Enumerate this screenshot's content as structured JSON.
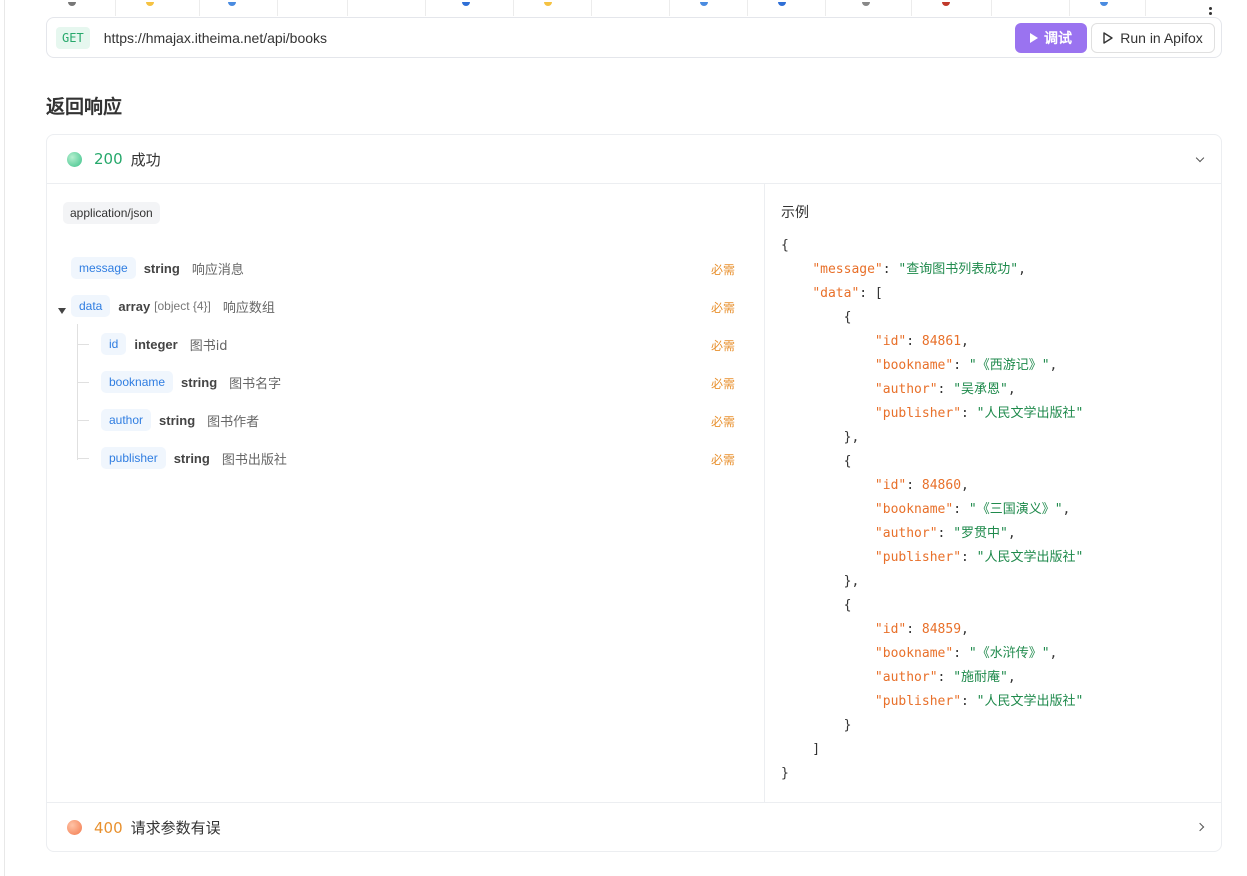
{
  "request": {
    "method": "GET",
    "url": "https://hmajax.itheima.net/api/books",
    "debug_label": "调试",
    "run_label": "Run in Apifox"
  },
  "response_section": {
    "title": "返回响应"
  },
  "responses": [
    {
      "code": "200",
      "text": "成功",
      "status": "success",
      "expanded": true
    },
    {
      "code": "400",
      "text": "请求参数有误",
      "status": "error",
      "expanded": false
    }
  ],
  "schema": {
    "content_type": "application/json",
    "required_label": "必需",
    "fields": [
      {
        "name": "message",
        "type": "string",
        "sub": "",
        "desc": "响应消息"
      },
      {
        "name": "data",
        "type": "array",
        "sub": "[object {4}]",
        "desc": "响应数组"
      },
      {
        "name": "id",
        "type": "integer",
        "sub": "",
        "desc": "图书id"
      },
      {
        "name": "bookname",
        "type": "string",
        "sub": "",
        "desc": "图书名字"
      },
      {
        "name": "author",
        "type": "string",
        "sub": "",
        "desc": "图书作者"
      },
      {
        "name": "publisher",
        "type": "string",
        "sub": "",
        "desc": "图书出版社"
      }
    ]
  },
  "example": {
    "title": "示例",
    "message": "查询图书列表成功",
    "books": [
      {
        "id": "84861",
        "bookname": "《西游记》",
        "author": "吴承恩",
        "publisher": "人民文学出版社"
      },
      {
        "id": "84860",
        "bookname": "《三国演义》",
        "author": "罗贯中",
        "publisher": "人民文学出版社"
      },
      {
        "id": "84859",
        "bookname": "《水浒传》",
        "author": "施耐庵",
        "publisher": "人民文学出版社"
      }
    ]
  },
  "colors": {
    "success": "#26a86b",
    "warning": "#e8912f",
    "accent": "#9a73f0",
    "link": "#2f7de1"
  }
}
